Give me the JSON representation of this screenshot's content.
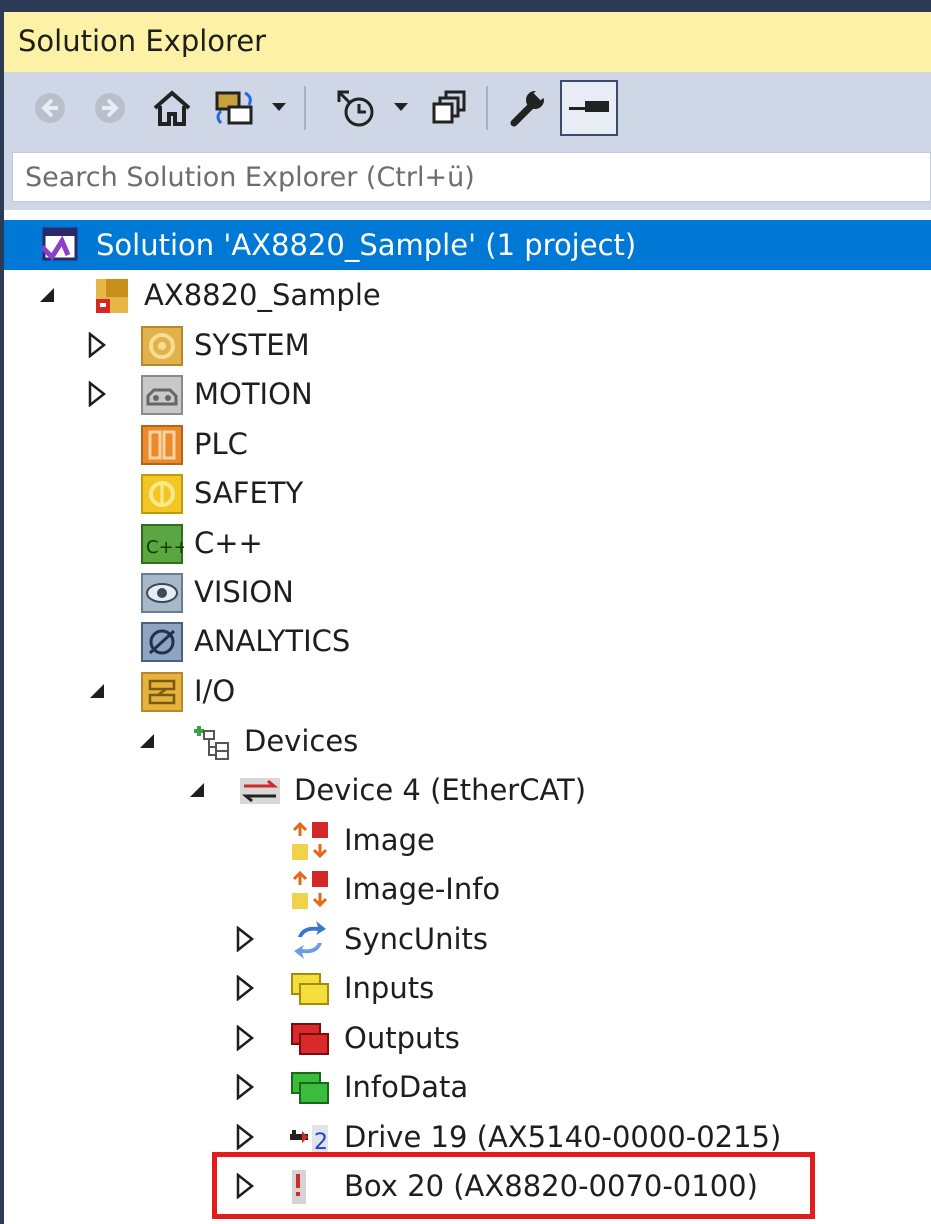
{
  "window": {
    "title": "Solution Explorer"
  },
  "toolbar": {
    "items": [
      "back-icon",
      "forward-icon",
      "home-icon",
      "sync-icon",
      "dropdown-arrow-icon",
      "pending-changes-icon",
      "dropdown-arrow-icon",
      "collapse-all-icon",
      "properties-icon",
      "pin-icon"
    ]
  },
  "search": {
    "placeholder": "Search Solution Explorer (Ctrl+ü)"
  },
  "tree": {
    "solution": "Solution 'AX8820_Sample' (1 project)",
    "project": "AX8820_Sample",
    "system": "SYSTEM",
    "motion": "MOTION",
    "plc": "PLC",
    "safety": "SAFETY",
    "cpp": "C++",
    "vision": "VISION",
    "analytics": "ANALYTICS",
    "io": "I/O",
    "devices": "Devices",
    "device4": "Device 4 (EtherCAT)",
    "image": "Image",
    "image_info": "Image-Info",
    "syncunits": "SyncUnits",
    "inputs": "Inputs",
    "outputs": "Outputs",
    "infodata": "InfoData",
    "drive19": "Drive 19 (AX5140-0000-0215)",
    "box20": "Box 20 (AX8820-0070-0100)"
  },
  "colors": {
    "selection": "#0079d6",
    "highlight_border": "#e11d1d",
    "title_bg": "#fdf1a6"
  }
}
